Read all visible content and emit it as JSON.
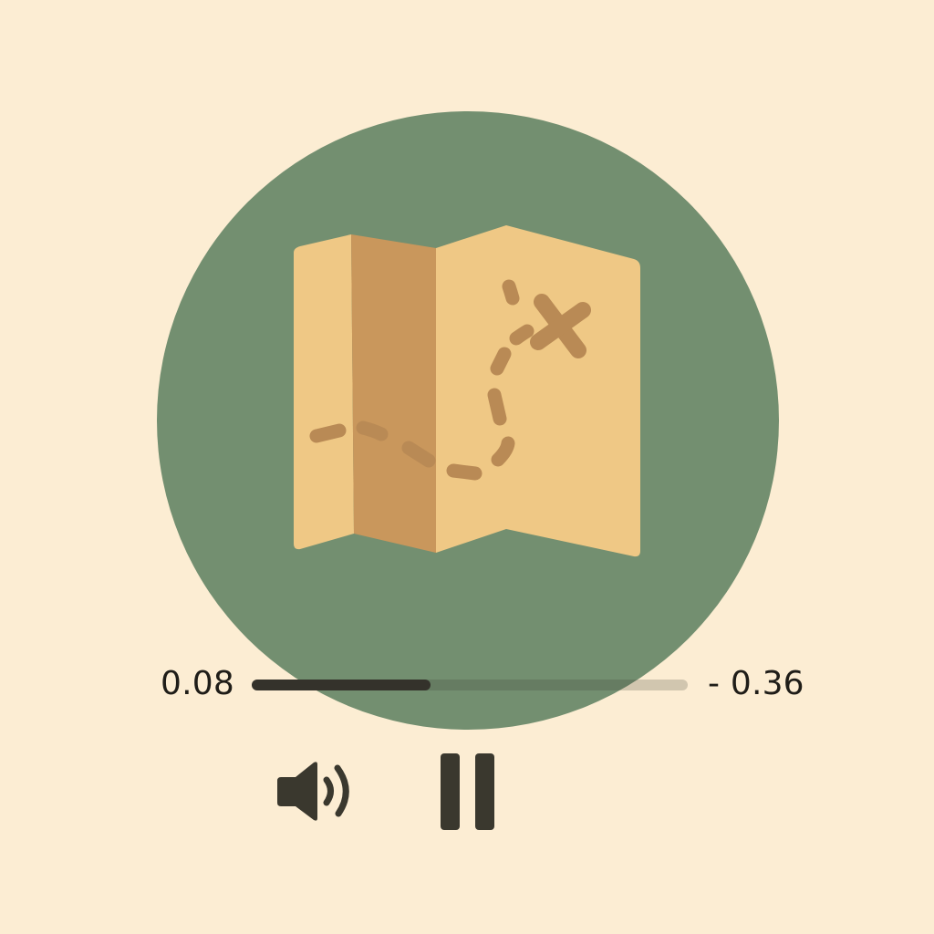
{
  "player": {
    "elapsed_time": "0.08",
    "remaining_time": "- 0.36",
    "progress": 0.41,
    "artwork_icon": "treasure-map-icon",
    "volume_icon": "speaker-icon",
    "playback_icon": "pause-icon"
  },
  "colors": {
    "background": "#fcedd3",
    "artwork_circle": "#738f70",
    "map_light": "#efc885",
    "map_dark": "#c9975c",
    "map_path": "#b98a55",
    "controls": "#3a382e"
  }
}
